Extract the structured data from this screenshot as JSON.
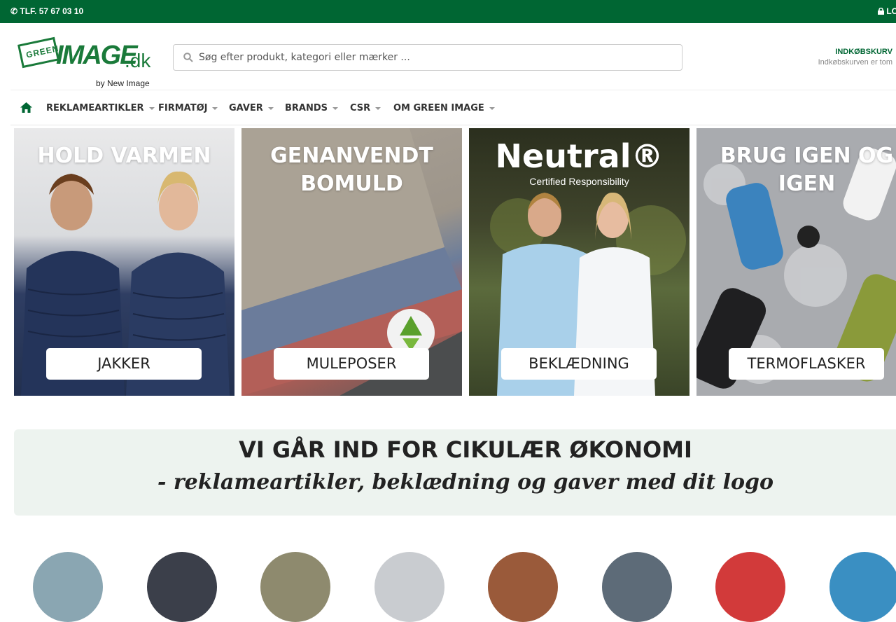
{
  "topbar": {
    "phone": "TLF. 57 67 03 10",
    "login": "LO"
  },
  "logo": {
    "badge": "GREEN",
    "word": "IMAGE",
    "suffix": ".dk",
    "byline": "by New Image"
  },
  "search": {
    "placeholder": "Søg efter produkt, kategori eller mærker ..."
  },
  "cart": {
    "title": "INDKØBSKURV",
    "status": "Indkøbskurven er tom"
  },
  "nav": [
    "REKLAMEARTIKLER",
    "FIRMATØJ",
    "GAVER",
    "BRANDS",
    "CSR",
    "OM GREEN IMAGE"
  ],
  "tiles": [
    {
      "headline": "HOLD VARMEN",
      "label": "JAKKER"
    },
    {
      "headline": "GENANVENDT BOMULD",
      "label": "MULEPOSER"
    },
    {
      "headline": "Neutral®",
      "subline": "Certified Responsibility",
      "label": "BEKLÆDNING"
    },
    {
      "headline": "BRUG IGEN OG IGEN",
      "label": "TERMOFLASKER"
    }
  ],
  "banner": {
    "line1": "VI GÅR IND FOR CIKULÆR ØKONOMI",
    "line2": "- reklameartikler, beklædning og gaver med dit logo"
  },
  "colors": {
    "brand_green": "#006633",
    "logo_green": "#1a7a3a"
  }
}
